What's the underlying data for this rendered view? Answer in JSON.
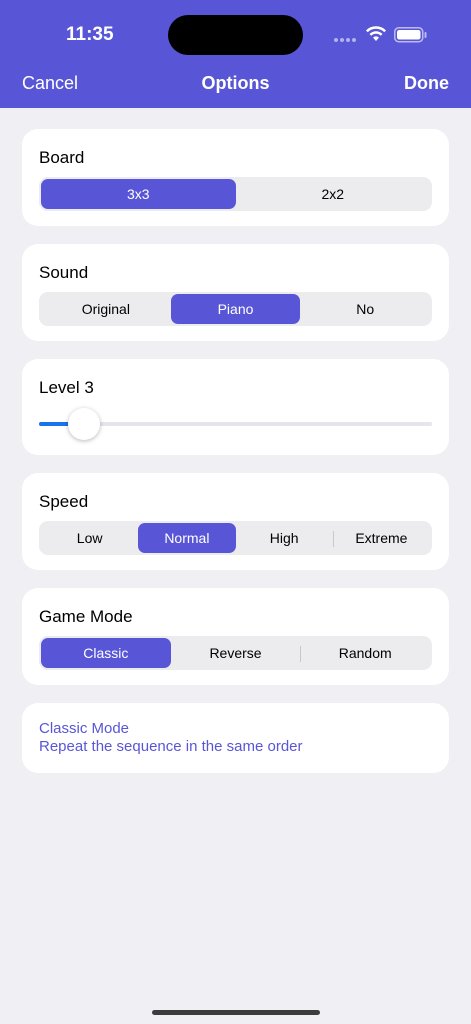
{
  "status_bar": {
    "time": "11:35",
    "icons": [
      "signal-icon",
      "wifi-icon",
      "battery-icon"
    ]
  },
  "nav": {
    "cancel_label": "Cancel",
    "title": "Options",
    "done_label": "Done"
  },
  "colors": {
    "accent": "#5856d6",
    "background": "#efeff4",
    "slider_fill": "#1a73e8"
  },
  "board": {
    "title": "Board",
    "options": [
      "3x3",
      "2x2"
    ],
    "selected": "3x3"
  },
  "sound": {
    "title": "Sound",
    "options": [
      "Original",
      "Piano",
      "No"
    ],
    "selected": "Piano"
  },
  "level": {
    "title": "Level 3",
    "slider_fraction": 0.08
  },
  "speed": {
    "title": "Speed",
    "options": [
      "Low",
      "Normal",
      "High",
      "Extreme"
    ],
    "selected": "Normal"
  },
  "game_mode": {
    "title": "Game Mode",
    "options": [
      "Classic",
      "Reverse",
      "Random"
    ],
    "selected": "Classic"
  },
  "mode_info": {
    "heading": "Classic Mode",
    "description": "Repeat the sequence in the same order"
  }
}
